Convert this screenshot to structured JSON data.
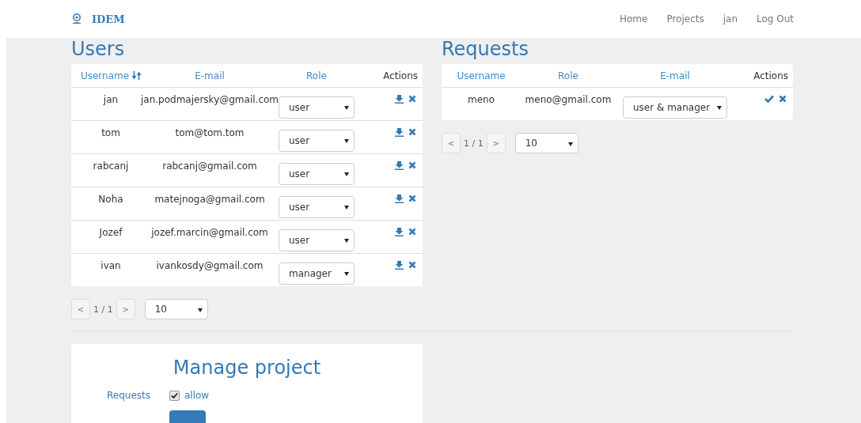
{
  "navbar": {
    "brand": "IDEM",
    "links": [
      "Home",
      "Projects",
      "jan",
      "Log Out"
    ]
  },
  "users": {
    "title": "Users",
    "columns": [
      "Username",
      "E-mail",
      "Role",
      "Actions"
    ],
    "rows": [
      {
        "username": "jan",
        "email": "jan.podmajersky@gmail.com",
        "role": "user"
      },
      {
        "username": "tom",
        "email": "tom@tom.tom",
        "role": "user"
      },
      {
        "username": "rabcanj",
        "email": "rabcanj@gmail.com",
        "role": "user"
      },
      {
        "username": "Noha",
        "email": "matejnoga@gmail.com",
        "role": "user"
      },
      {
        "username": "Jozef",
        "email": "jozef.marcin@gmail.com",
        "role": "user"
      },
      {
        "username": "ivan",
        "email": "ivankosdy@gmail.com",
        "role": "manager"
      }
    ],
    "pager": {
      "prev": "<",
      "page": "1 / 1",
      "next": ">",
      "page_size": "10"
    }
  },
  "requests": {
    "title": "Requests",
    "columns": [
      "Username",
      "Role",
      "E-mail",
      "Actions"
    ],
    "rows": [
      {
        "username": "meno",
        "email": "meno@gmail.com",
        "role": "user & manager"
      }
    ],
    "pager": {
      "prev": "<",
      "page": "1 / 1",
      "next": ">",
      "page_size": "10"
    }
  },
  "manage": {
    "title": "Manage project",
    "label": "Requests",
    "option": "allow",
    "checked": true
  }
}
